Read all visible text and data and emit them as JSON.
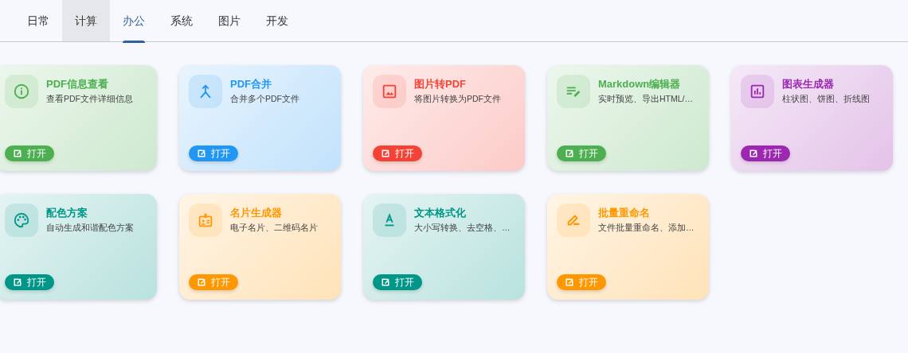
{
  "tabs": [
    {
      "label": "日常",
      "selected": false,
      "hovered": false
    },
    {
      "label": "计算",
      "selected": false,
      "hovered": true
    },
    {
      "label": "办公",
      "selected": true,
      "hovered": false
    },
    {
      "label": "系统",
      "selected": false,
      "hovered": false
    },
    {
      "label": "图片",
      "selected": false,
      "hovered": false
    },
    {
      "label": "开发",
      "selected": false,
      "hovered": false
    }
  ],
  "cards": [
    {
      "title": "PDF信息查看",
      "description": "查看PDF文件详细信息",
      "button": "打开",
      "color": "#4caf50"
    },
    {
      "title": "PDF合并",
      "description": "合并多个PDF文件",
      "button": "打开",
      "color": "#2196f3"
    },
    {
      "title": "图片转PDF",
      "description": "将图片转换为PDF文件",
      "button": "打开",
      "color": "#f44336"
    },
    {
      "title": "Markdown编辑器",
      "description": "实时预览、导出HTML/…",
      "button": "打开",
      "color": "#4caf50"
    },
    {
      "title": "图表生成器",
      "description": "柱状图、饼图、折线图",
      "button": "打开",
      "color": "#9c27b0"
    },
    {
      "title": "配色方案",
      "description": "自动生成和谐配色方案",
      "button": "打开",
      "color": "#009688"
    },
    {
      "title": "名片生成器",
      "description": "电子名片、二维码名片",
      "button": "打开",
      "color": "#ff9800"
    },
    {
      "title": "文本格式化",
      "description": "大小写转换、去空格、…",
      "button": "打开",
      "color": "#009688"
    },
    {
      "title": "批量重命名",
      "description": "文件批量重命名、添加…",
      "button": "打开",
      "color": "#ff9800"
    }
  ]
}
